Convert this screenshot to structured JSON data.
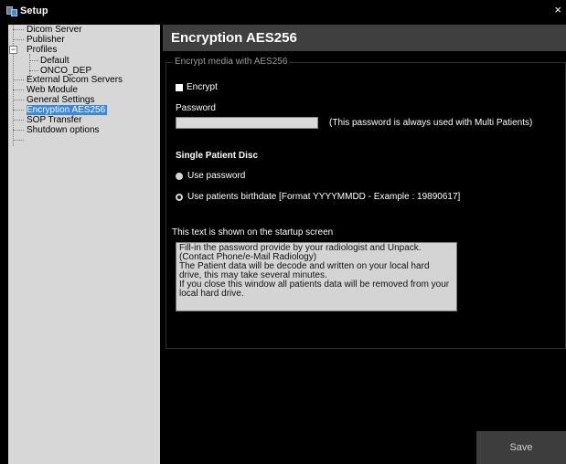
{
  "window": {
    "title": "Setup",
    "close_label": "×"
  },
  "sidebar": {
    "items": [
      {
        "label": "Dicom Server"
      },
      {
        "label": "Publisher"
      },
      {
        "label": "Profiles",
        "expander": "−"
      },
      {
        "label": "Default"
      },
      {
        "label": "ONCO_DEP"
      },
      {
        "label": "External Dicom Servers"
      },
      {
        "label": "Web Module"
      },
      {
        "label": "General Settings"
      },
      {
        "label": "Encryption AES256",
        "selected": true
      },
      {
        "label": "SOP Transfer"
      },
      {
        "label": "Shutdown options"
      }
    ]
  },
  "main": {
    "header_title": "Encryption AES256",
    "group_legend": "Encrypt media with AES256",
    "encrypt_label": "Encrypt",
    "encrypt_checked": false,
    "password_label": "Password",
    "password_value": "",
    "password_note": "(This password is always used with Multi Patients)",
    "single_patient_title": "Single Patient Disc",
    "radio_use_password": "Use password",
    "radio_use_birthdate": "Use patients birthdate [Format YYYYMMDD - Example : 19890617]",
    "selected_radio": "birthdate",
    "startup_label": "This text is shown on the startup screen",
    "startup_text": "Fill-in the password provide by your radiologist and Unpack. (Contact Phone/e-Mail Radiology)\nThe Patient data will be decode and written on your local hard drive, this may take several minutes.\nIf you close this window all patients data will be removed from your local hard drive.",
    "save_label": "Save"
  },
  "colors": {
    "background": "#000000",
    "header_bar": "#3f3f3f",
    "sidebar": "#d7d7d7",
    "selection": "#3a87e1",
    "save_button": "#3d3d3d"
  }
}
